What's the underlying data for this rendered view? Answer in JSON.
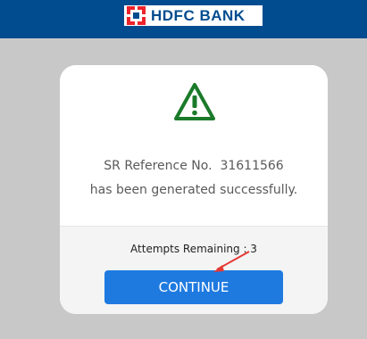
{
  "header": {
    "logo_text": "HDFC BANK",
    "bg_color": "#004c8f",
    "logo_mark_color": "#ed232a"
  },
  "dialog": {
    "icon": "warning-triangle-icon",
    "icon_color": "#1a7a2a",
    "message_line1": "SR Reference No.  31611566",
    "message_line2": "has been generated successfully.",
    "attempts_label": "Attempts Remaining : 3",
    "continue_label": "CONTINUE",
    "button_color": "#1f7ae0"
  },
  "annotation": {
    "arrow_color": "#e53935"
  }
}
